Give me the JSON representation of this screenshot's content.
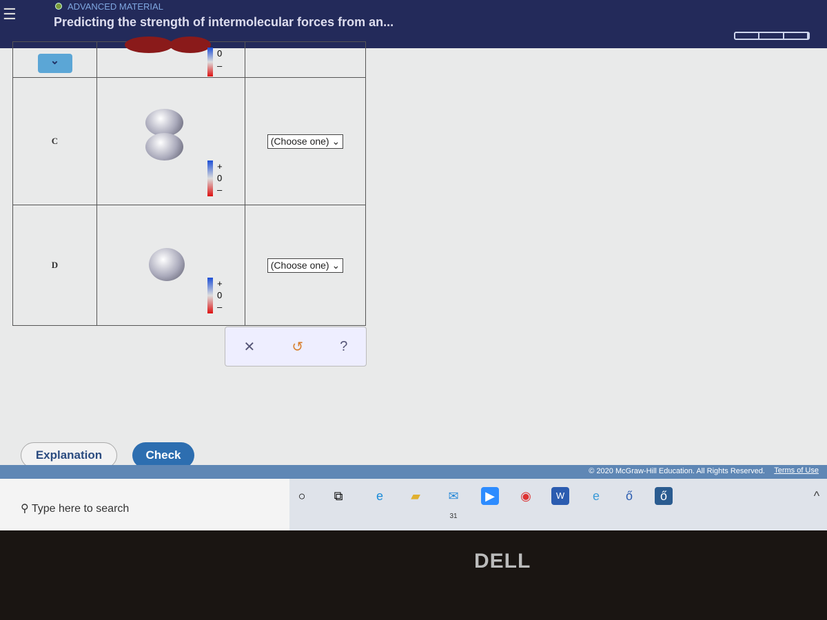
{
  "header": {
    "breadcrumb": "ADVANCED MATERIAL",
    "title": "Predicting the strength of intermolecular forces from an..."
  },
  "table": {
    "rows": [
      {
        "label": "",
        "scale": [
          "0",
          "–"
        ]
      },
      {
        "label": "C",
        "select": "(Choose one)",
        "scale": [
          "+",
          "0",
          "–"
        ]
      },
      {
        "label": "D",
        "select": "(Choose one)",
        "scale": [
          "+",
          "0",
          "–"
        ]
      }
    ]
  },
  "tools": {
    "clear": "✕",
    "undo": "↺",
    "help": "?"
  },
  "buttons": {
    "explanation": "Explanation",
    "check": "Check"
  },
  "footer": {
    "copyright": "© 2020 McGraw-Hill Education. All Rights Reserved.",
    "terms": "Terms of Use"
  },
  "taskbar": {
    "search_placeholder": "Type here to search",
    "mail_badge": "31"
  },
  "brand": "DELL"
}
